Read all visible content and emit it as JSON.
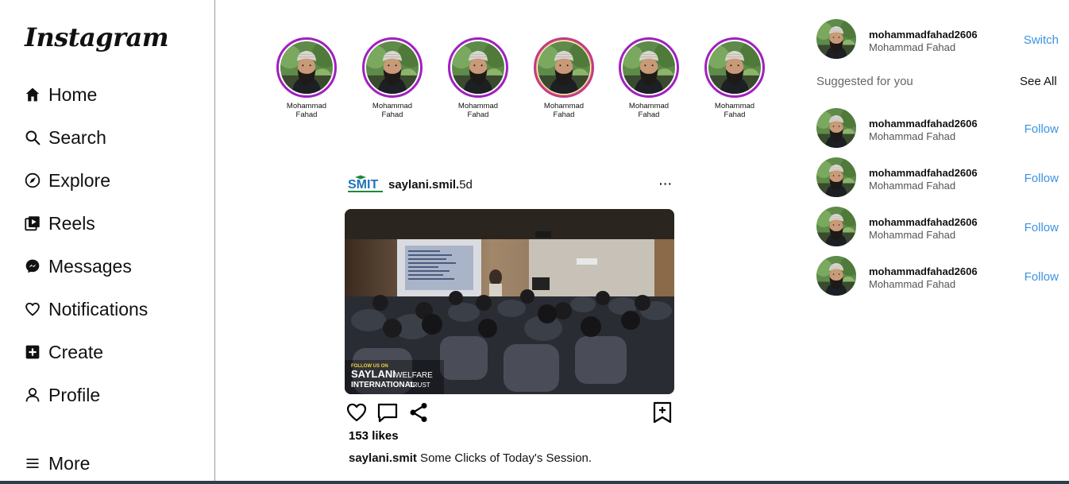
{
  "sidebar": {
    "logo": "Instagram",
    "items": [
      {
        "label": "Home",
        "icon": "home-icon"
      },
      {
        "label": "Search",
        "icon": "search-icon"
      },
      {
        "label": "Explore",
        "icon": "compass-icon"
      },
      {
        "label": "Reels",
        "icon": "reels-icon"
      },
      {
        "label": "Messages",
        "icon": "messenger-icon"
      },
      {
        "label": "Notifications",
        "icon": "heart-icon"
      },
      {
        "label": "Create",
        "icon": "plus-square-icon"
      },
      {
        "label": "Profile",
        "icon": "user-icon"
      }
    ],
    "more": {
      "label": "More",
      "icon": "menu-icon"
    }
  },
  "stories": [
    {
      "name": "Mohammad Fahad"
    },
    {
      "name": "Mohammad Fahad"
    },
    {
      "name": "Mohammad Fahad"
    },
    {
      "name": "Mohammad Fahad"
    },
    {
      "name": "Mohammad Fahad"
    },
    {
      "name": "Mohammad Fahad"
    }
  ],
  "post": {
    "username": "saylani.smil.",
    "age": "5d",
    "brand_logo_text": "SMIT",
    "more": "···",
    "image_overlay": {
      "follow": "FOLLOW US ON",
      "line1": "SAYLANI",
      "line1b": "WELFARE",
      "line2": "INTERNATIONAL",
      "line2b": "TRUST"
    },
    "likes": "153 likes",
    "caption_user": "saylani.smit",
    "caption_text": " Some Clicks of Today's Session."
  },
  "right": {
    "current_user": {
      "username": "mohammadfahad2606",
      "name": "Mohammad Fahad",
      "action": "Switch"
    },
    "suggested_label": "Suggested for you",
    "see_all": "See All",
    "suggestions": [
      {
        "username": "mohammadfahad2606",
        "name": "Mohammad Fahad",
        "action": "Follow"
      },
      {
        "username": "mohammadfahad2606",
        "name": "Mohammad Fahad",
        "action": "Follow"
      },
      {
        "username": "mohammadfahad2606",
        "name": "Mohammad Fahad",
        "action": "Follow"
      },
      {
        "username": "mohammadfahad2606",
        "name": "Mohammad Fahad",
        "action": "Follow"
      }
    ]
  },
  "colors": {
    "story_ring": "#a020c0",
    "link_blue": "#3b93e0",
    "divider": "#9a9a9a"
  }
}
